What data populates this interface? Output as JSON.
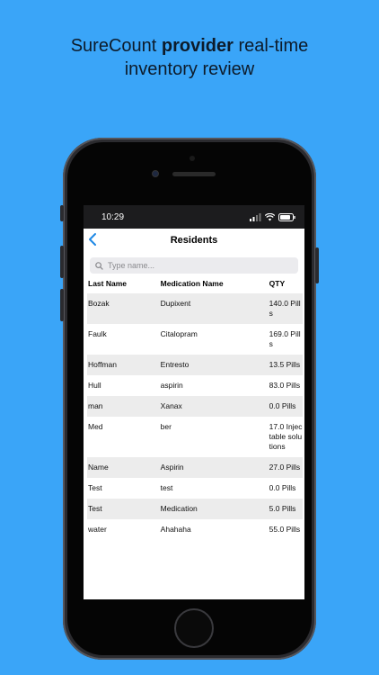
{
  "headline": {
    "line1_prefix": "SureCount",
    "line1_bold": "provider",
    "line1_suffix": "real-time",
    "line2": "inventory review"
  },
  "status_bar": {
    "time": "10:29"
  },
  "nav": {
    "title": "Residents",
    "back_icon": "chevron-left-icon"
  },
  "search": {
    "placeholder": "Type name..."
  },
  "table": {
    "headers": [
      "Last Name",
      "Medication Name",
      "QTY"
    ],
    "rows": [
      {
        "last_name": "Bozak",
        "medication": "Dupixent",
        "qty": "140.0 Pills"
      },
      {
        "last_name": "Faulk",
        "medication": "Citalopram",
        "qty": "169.0 Pills"
      },
      {
        "last_name": "Hoffman",
        "medication": "Entresto",
        "qty": "13.5 Pills"
      },
      {
        "last_name": "Hull",
        "medication": "aspirin",
        "qty": "83.0 Pills"
      },
      {
        "last_name": "man",
        "medication": "Xanax",
        "qty": "0.0 Pills"
      },
      {
        "last_name": "Med",
        "medication": "ber",
        "qty": "17.0 Injectable solutions"
      },
      {
        "last_name": "Name",
        "medication": "Aspirin",
        "qty": "27.0 Pills"
      },
      {
        "last_name": "Test",
        "medication": "test",
        "qty": "0.0 Pills"
      },
      {
        "last_name": "Test",
        "medication": "Medication",
        "qty": "5.0 Pills"
      },
      {
        "last_name": "water",
        "medication": "Ahahaha",
        "qty": "55.0 Pills"
      }
    ]
  },
  "colors": {
    "background": "#3aa5f8",
    "accent": "#1e88e5",
    "row_shade": "#ececec"
  }
}
